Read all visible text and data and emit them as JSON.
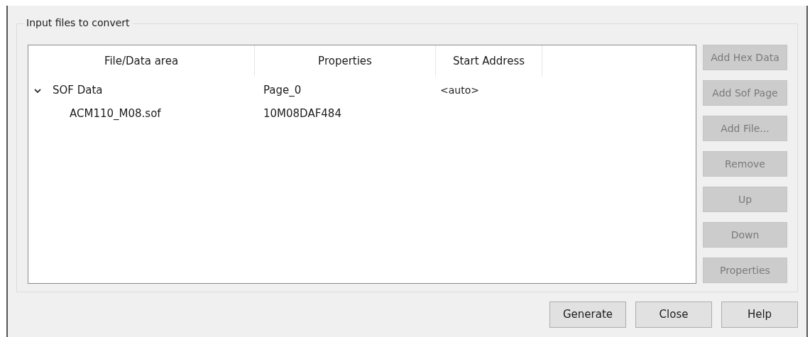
{
  "group": {
    "title": "Input files to convert"
  },
  "table": {
    "columns": [
      "File/Data area",
      "Properties",
      "Start Address"
    ],
    "rows": [
      {
        "name": "SOF Data",
        "properties": "Page_0",
        "start_address": "<auto>",
        "expanded": true,
        "children": [
          {
            "name": "ACM110_M08.sof",
            "properties": "10M08DAF484"
          }
        ]
      }
    ]
  },
  "side_buttons": [
    {
      "label": "Add Hex Data",
      "disabled": true
    },
    {
      "label": "Add Sof Page",
      "disabled": true
    },
    {
      "label": "Add File...",
      "disabled": true
    },
    {
      "label": "Remove",
      "disabled": true
    },
    {
      "label": "Up",
      "disabled": true
    },
    {
      "label": "Down",
      "disabled": true
    },
    {
      "label": "Properties",
      "disabled": true
    }
  ],
  "buttons": [
    "Generate",
    "Close",
    "Help"
  ]
}
